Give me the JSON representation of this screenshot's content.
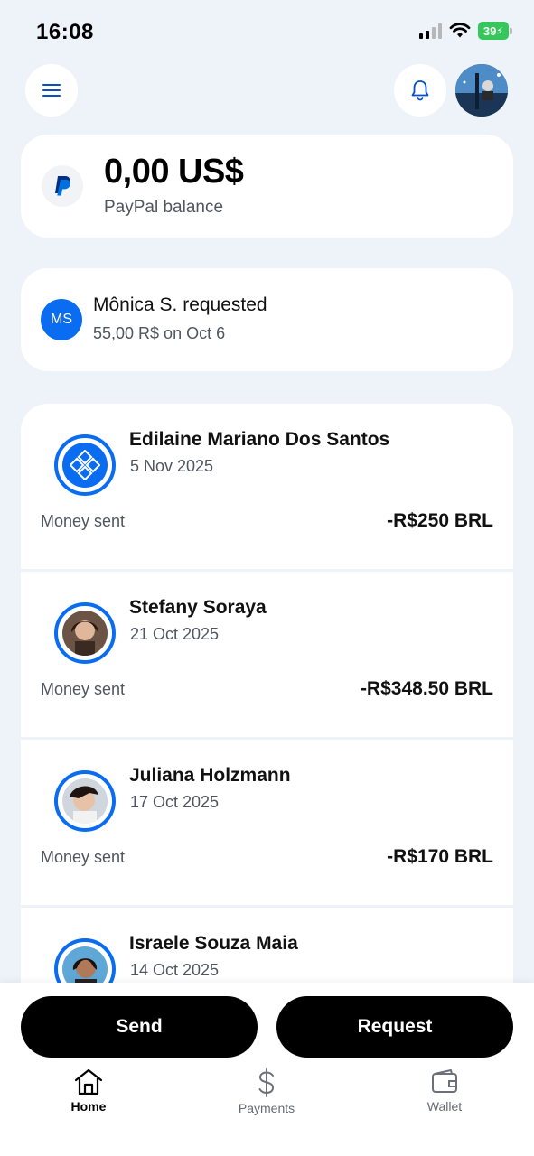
{
  "status_bar": {
    "time": "16:08",
    "battery": "39"
  },
  "header": {
    "menu_icon": "hamburger-menu-icon",
    "notification_icon": "bell-icon"
  },
  "balance": {
    "amount": "0,00 US$",
    "label": "PayPal balance"
  },
  "request": {
    "initials": "MS",
    "title": "Mônica S. requested",
    "subtitle": "55,00 R$ on Oct 6"
  },
  "transactions": [
    {
      "name": "Edilaine Mariano Dos Santos",
      "date": "5 Nov 2025",
      "type": "Money sent",
      "amount": "-R$250 BRL"
    },
    {
      "name": "Stefany Soraya",
      "date": "21 Oct 2025",
      "type": "Money sent",
      "amount": "-R$348.50 BRL"
    },
    {
      "name": "Juliana Holzmann",
      "date": "17 Oct 2025",
      "type": "Money sent",
      "amount": "-R$170 BRL"
    },
    {
      "name": "Israele Souza Maia",
      "date": "14 Oct 2025"
    }
  ],
  "actions": {
    "send": "Send",
    "request": "Request"
  },
  "nav": {
    "home": "Home",
    "payments": "Payments",
    "wallet": "Wallet"
  },
  "colors": {
    "accent": "#0a6cf0",
    "background": "#eef2f9",
    "battery": "#35c759"
  }
}
